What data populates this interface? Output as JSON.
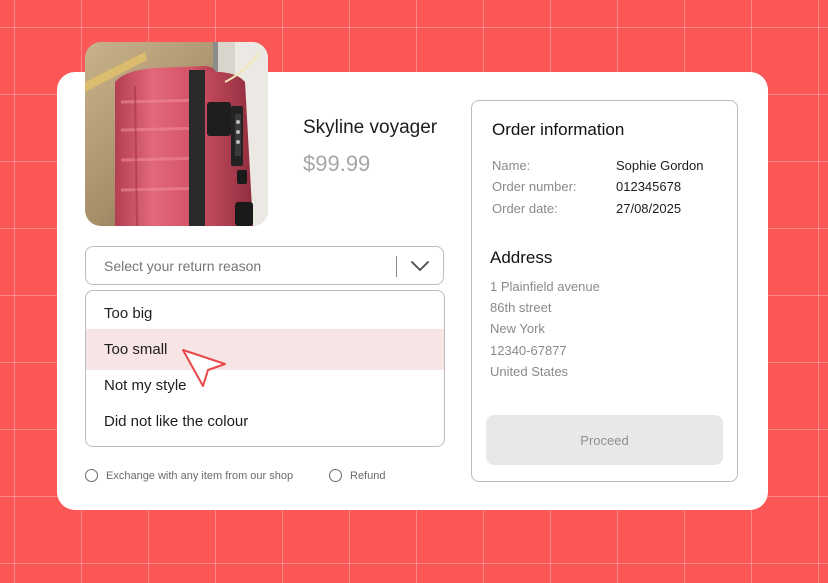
{
  "product": {
    "name": "Skyline voyager",
    "price": "$99.99",
    "image": "pink-suitcase-photo"
  },
  "return_reason": {
    "placeholder": "Select your return reason",
    "options": [
      {
        "label": "Too big"
      },
      {
        "label": "Too small"
      },
      {
        "label": "Not my style"
      },
      {
        "label": "Did not like the colour"
      }
    ],
    "highlighted_option": "Too small"
  },
  "resolution": {
    "exchange_label": "Exchange with any item from our shop",
    "refund_label": "Refund"
  },
  "order": {
    "title": "Order information",
    "fields": [
      {
        "label": "Name:",
        "value": "Sophie Gordon"
      },
      {
        "label": "Order number:",
        "value": "012345678"
      },
      {
        "label": "Order date:",
        "value": "27/08/2025"
      }
    ]
  },
  "address": {
    "title": "Address",
    "lines": [
      "1 Plainfield avenue",
      "86th street",
      "New York",
      "12340-67877",
      "United States"
    ]
  },
  "actions": {
    "proceed_label": "Proceed"
  },
  "colors": {
    "background": "#fc5757",
    "highlight": "#f7e4e4",
    "cursor": "#e8484a",
    "suitcase": "#d9566a"
  },
  "icons": {
    "select_chevron": "chevron-down-icon",
    "pointer": "cursor-arrow-icon"
  }
}
